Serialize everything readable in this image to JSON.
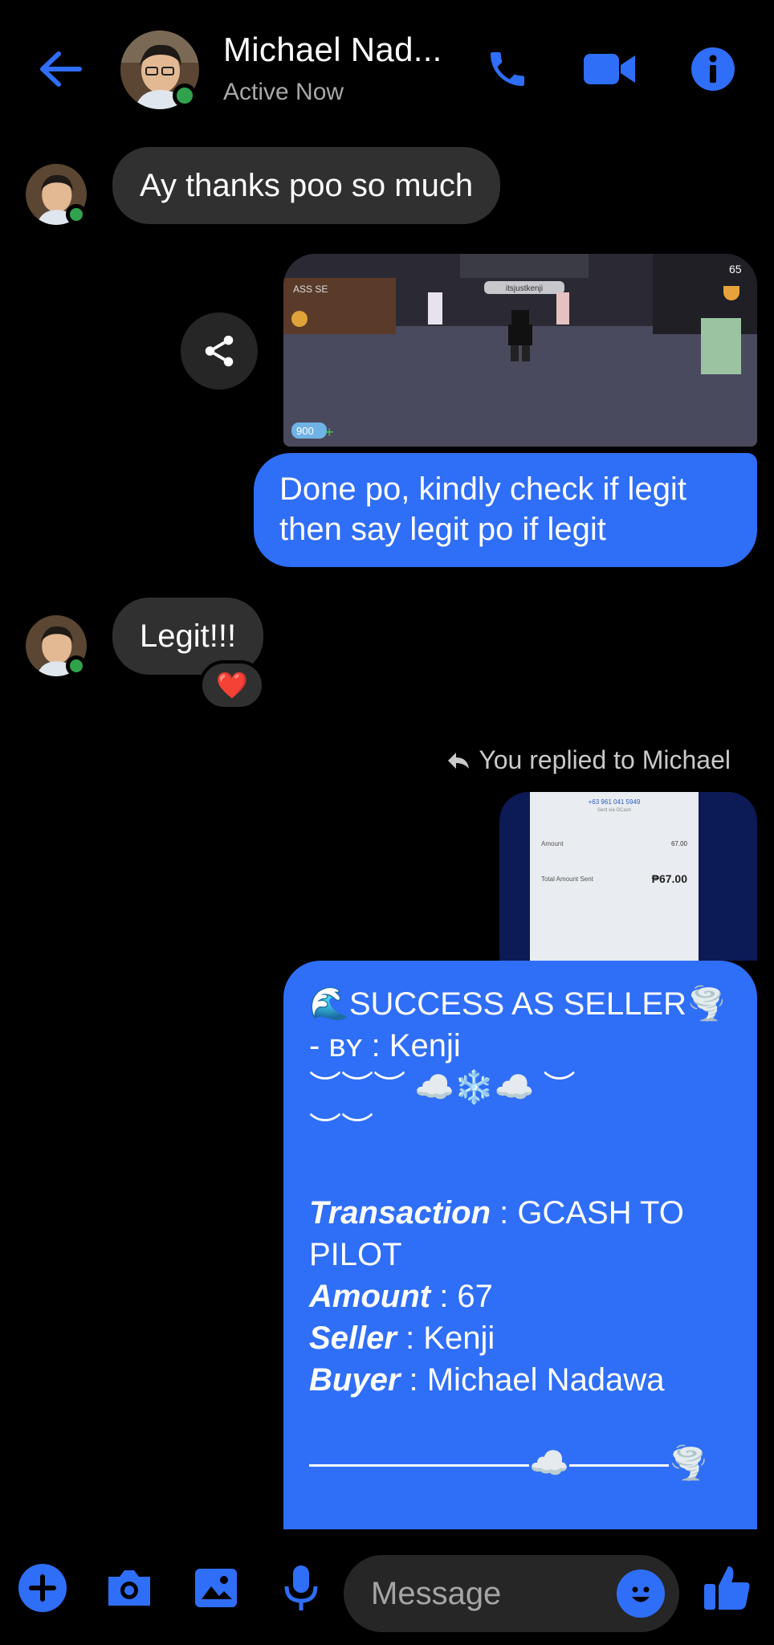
{
  "header": {
    "title": "Michael Nad...",
    "status": "Active Now"
  },
  "messages": {
    "m1": "Ay thanks poo so much",
    "m2_line1": "Done po, kindly check if legit",
    "m2_line2": "then say legit po if legit",
    "m3": "Legit!!!",
    "reaction": "❤️",
    "reply_note": "You replied to Michael"
  },
  "game_screenshot": {
    "top_left_text": "ASS SE",
    "player_tag": "itsjustkenji",
    "coins": "900",
    "top_right": "65"
  },
  "receipt": {
    "phone": "+63 961 041 5949",
    "sent_via": "Sent via GCash",
    "amount_label": "Amount",
    "amount_value": "67.00",
    "total_label": "Total Amount Sent",
    "total_value": "₱67.00"
  },
  "success": {
    "title_emoji_left": "🌊",
    "title": "SUCCESS AS SELLER",
    "title_emoji_right": "🌪️",
    "by_line": "- ʙʏ : Kenji",
    "deco1": "︶︶︶ ☁️❄️☁️ ︶",
    "deco2": "︶︶",
    "transaction_label": "Transaction",
    "transaction_value": " : GCASH TO PILOT",
    "amount_label": "Amount",
    "amount_value": " : 67",
    "seller_label": "Seller",
    "seller_value": " : Kenji",
    "buyer_label": "Buyer",
    "buyer_value": " : Michael Nadawa",
    "cloud": "☁️",
    "tornado": "🌪️"
  },
  "footer": {
    "placeholder": "Message"
  },
  "colors": {
    "accent": "#2f6ef7",
    "bubble_in": "#303030",
    "online": "#31a24c"
  }
}
